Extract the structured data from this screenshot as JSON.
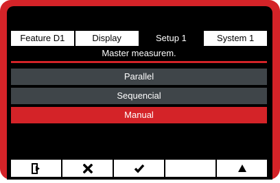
{
  "tabs": [
    {
      "label": "Feature  D1",
      "active": false
    },
    {
      "label": "Display",
      "active": false
    },
    {
      "label": "Setup 1",
      "active": true
    },
    {
      "label": "System 1",
      "active": false
    }
  ],
  "screen_title": "Master measurem.",
  "menu": {
    "items": [
      {
        "label": "Parallel",
        "selected": false
      },
      {
        "label": "Sequencial",
        "selected": false
      },
      {
        "label": "Manual",
        "selected": true
      }
    ]
  },
  "toolbar": {
    "buttons": [
      {
        "icon": "exit-icon"
      },
      {
        "icon": "cross-icon"
      },
      {
        "icon": "checkmark-icon"
      },
      {
        "icon": ""
      },
      {
        "icon": "up-arrow-icon"
      }
    ]
  },
  "colors": {
    "accent": "#d42328",
    "item_bg": "#3f4549",
    "screen_bg": "#000000"
  }
}
